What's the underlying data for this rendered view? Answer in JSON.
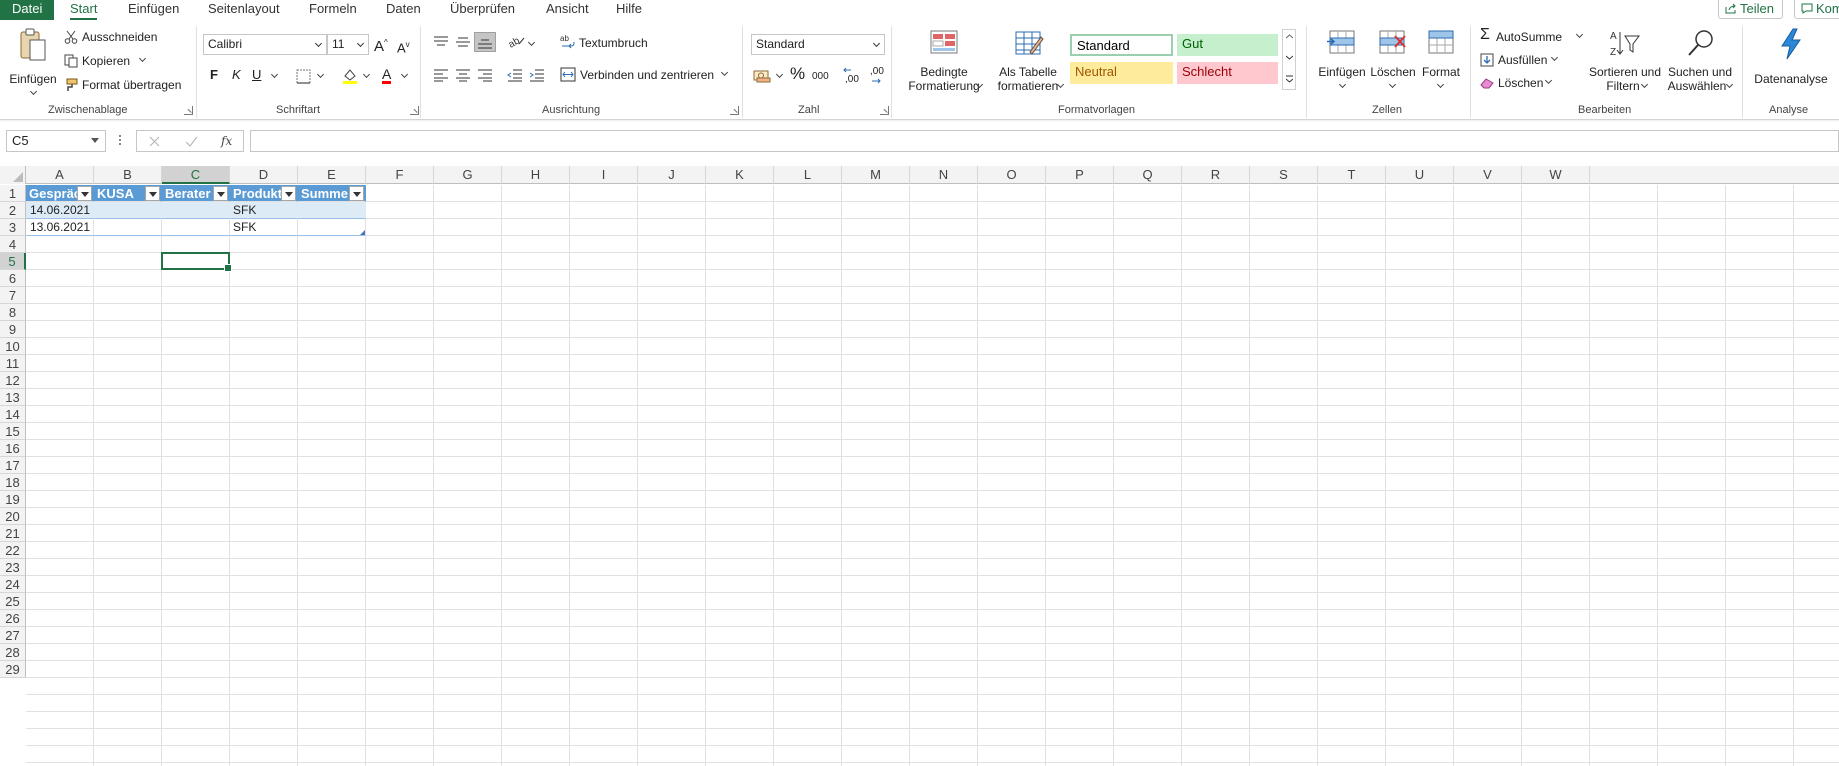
{
  "menu": {
    "tabs": [
      {
        "label": "Datei"
      },
      {
        "label": "Start"
      },
      {
        "label": "Einfügen"
      },
      {
        "label": "Seitenlayout"
      },
      {
        "label": "Formeln"
      },
      {
        "label": "Daten"
      },
      {
        "label": "Überprüfen"
      },
      {
        "label": "Ansicht"
      },
      {
        "label": "Hilfe"
      }
    ],
    "share_label": "Teilen",
    "comments_label": "Kom"
  },
  "ribbon": {
    "clipboard": {
      "paste": "Einfügen",
      "cut": "Ausschneiden",
      "copy": "Kopieren",
      "format_painter": "Format übertragen",
      "group": "Zwischenablage"
    },
    "font": {
      "name": "Calibri",
      "size": "11",
      "grow": "A",
      "shrink": "A",
      "bold": "F",
      "italic": "K",
      "underline": "U",
      "color_letter": "A",
      "group": "Schriftart"
    },
    "alignment": {
      "wrap": "Textumbruch",
      "merge": "Verbinden und zentrieren",
      "group": "Ausrichtung"
    },
    "number": {
      "format": "Standard",
      "percent": "%",
      "thousands": "000",
      "inc_decimal": ",00",
      "dec_decimal": ",00",
      "group": "Zahl"
    },
    "styles": {
      "conditional_line1": "Bedingte",
      "conditional_line2": "Formatierung",
      "as_table_line1": "Als Tabelle",
      "as_table_line2": "formatieren",
      "standard": "Standard",
      "good": "Gut",
      "neutral": "Neutral",
      "bad": "Schlecht",
      "group": "Formatvorlagen"
    },
    "cells": {
      "insert": "Einfügen",
      "delete": "Löschen",
      "format": "Format",
      "group": "Zellen"
    },
    "editing": {
      "autosum": "AutoSumme",
      "fill": "Ausfüllen",
      "clear": "Löschen",
      "sort_line1": "Sortieren und",
      "sort_line2": "Filtern",
      "find_line1": "Suchen und",
      "find_line2": "Auswählen",
      "group": "Bearbeiten"
    },
    "analysis": {
      "data_analysis": "Datenanalyse",
      "group": "Analyse"
    }
  },
  "formula_bar": {
    "name_box": "C5",
    "fx": "fx",
    "formula": ""
  },
  "sheet": {
    "columns": [
      "A",
      "B",
      "C",
      "D",
      "E",
      "F",
      "G",
      "H",
      "I",
      "J",
      "K",
      "L",
      "M",
      "N",
      "O",
      "P",
      "Q",
      "R",
      "S",
      "T",
      "U",
      "V",
      "W"
    ],
    "rows": [
      "1",
      "2",
      "3",
      "4",
      "5",
      "6",
      "7",
      "8",
      "9",
      "10",
      "11",
      "12",
      "13",
      "14",
      "15",
      "16",
      "17",
      "18",
      "19",
      "20",
      "21",
      "22",
      "23",
      "24",
      "25",
      "26",
      "27",
      "28",
      "29"
    ],
    "selected_column": "C",
    "selected_row": "5",
    "table_headers": [
      "Gespräch",
      "KUSA",
      "Berater",
      "Produkt",
      "Summe"
    ],
    "table_rows": [
      [
        "14.06.2021",
        "",
        "",
        "SFK",
        ""
      ],
      [
        "13.06.2021",
        "",
        "",
        "SFK",
        ""
      ]
    ]
  },
  "colors": {
    "accent": "#217346",
    "table_header": "#5b9bd5",
    "table_band": "#ddebf7",
    "good_bg": "#c6efce",
    "neutral_bg": "#ffeb9c",
    "bad_bg": "#ffc7ce"
  }
}
